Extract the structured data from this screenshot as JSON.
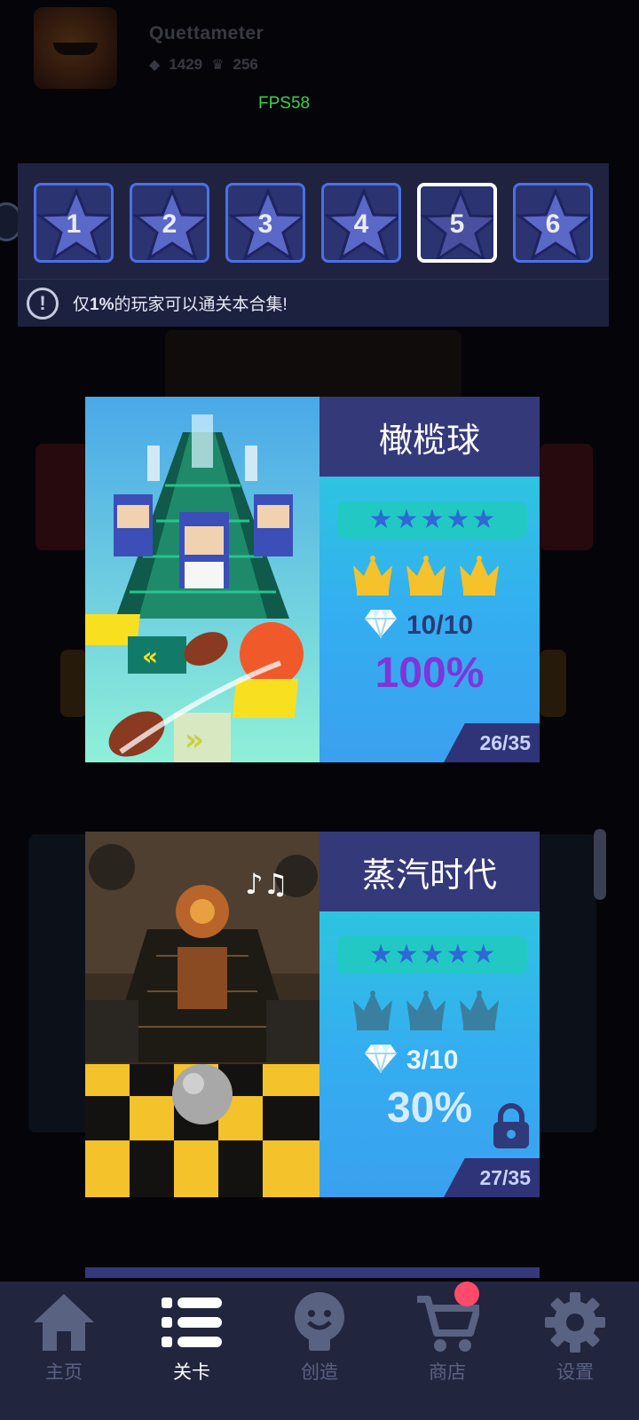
{
  "profile": {
    "username": "Quettameter",
    "gems": "1429",
    "crowns": "256"
  },
  "fps_label": "FPS58",
  "level_selector": {
    "levels": [
      "1",
      "2",
      "3",
      "4",
      "5",
      "6"
    ],
    "selected": "5",
    "notice_prefix": "仅",
    "notice_highlight": "1%",
    "notice_suffix": "的玩家可以通关本合集!"
  },
  "songs": [
    {
      "title": "橄榄球",
      "difficulty_stars": 5,
      "crowns_earned": 3,
      "gems": "10/10",
      "percent": "100%",
      "index": "26/35",
      "locked": false
    },
    {
      "title": "蒸汽时代",
      "difficulty_stars": 5,
      "crowns_earned": 0,
      "gems": "3/10",
      "percent": "30%",
      "index": "27/35",
      "locked": true
    }
  ],
  "nav": {
    "items": [
      {
        "label": "主页",
        "icon": "home-icon"
      },
      {
        "label": "关卡",
        "icon": "list-icon"
      },
      {
        "label": "创造",
        "icon": "lightbulb-icon"
      },
      {
        "label": "商店",
        "icon": "cart-icon"
      },
      {
        "label": "设置",
        "icon": "gear-icon"
      }
    ],
    "active_index": 1,
    "store_has_badge": true
  },
  "colors": {
    "accent_blue": "#4c70e4",
    "card_header": "#34397a",
    "percent_complete": "#7f36d8",
    "percent_partial": "#d6ecff",
    "crown_gold": "#f5c22b",
    "crown_dim": "#3a7fa0",
    "badge_red": "#ff4a6a",
    "fps_green": "#3cd24a"
  }
}
